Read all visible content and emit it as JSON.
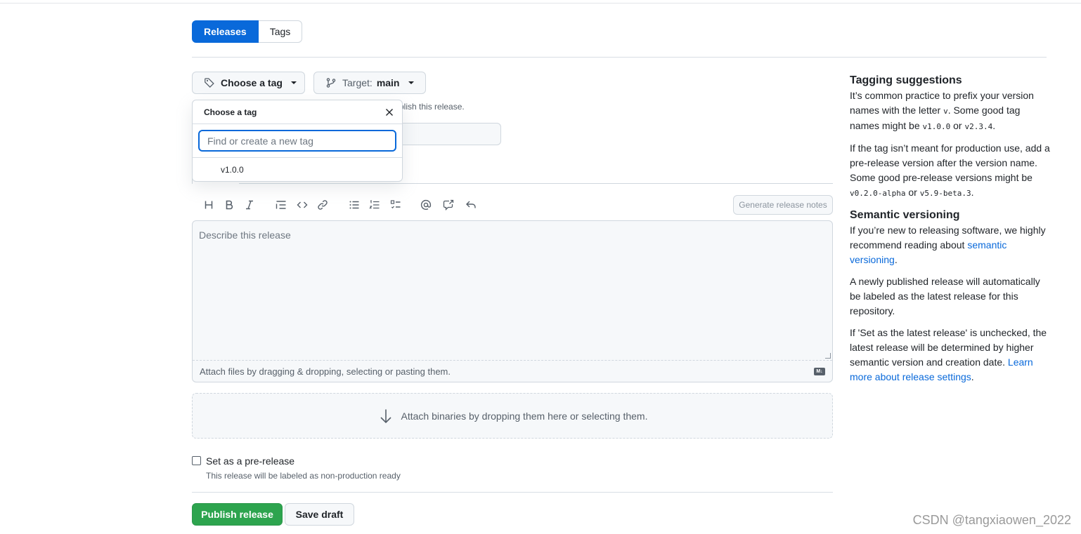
{
  "tabs": {
    "releases": "Releases",
    "tags": "Tags"
  },
  "tag_button": {
    "label": "Choose a tag"
  },
  "target_button": {
    "label": "Target:",
    "value": "main"
  },
  "hint": "blish this release.",
  "dropdown": {
    "title": "Choose a tag",
    "search_placeholder": "Find or create a new tag",
    "items": [
      "v1.0.0"
    ]
  },
  "editor": {
    "generate_notes": "Generate release notes",
    "placeholder": "Describe this release",
    "attach_hint": "Attach files by dragging & dropping, selecting or pasting them.",
    "markdown_badge": "M↓"
  },
  "binaries": {
    "label": "Attach binaries by dropping them here or selecting them."
  },
  "prerelease": {
    "label": "Set as a pre-release",
    "note": "This release will be labeled as non-production ready"
  },
  "actions": {
    "publish": "Publish release",
    "save_draft": "Save draft"
  },
  "sidebar": {
    "tagging_title": "Tagging suggestions",
    "p1_a": "It’s common practice to prefix your version names with the letter ",
    "p1_code1": "v",
    "p1_b": ". Some good tag names might be ",
    "p1_code2": "v1.0.0",
    "p1_c": " or ",
    "p1_code3": "v2.3.4",
    "p1_d": ".",
    "p2_a": "If the tag isn’t meant for production use, add a pre-release version after the version name. Some good pre-release versions might be ",
    "p2_code1": "v0.2.0-alpha",
    "p2_b": " or ",
    "p2_code2": "v5.9-beta.3",
    "p2_c": ".",
    "semver_title": "Semantic versioning",
    "p3_a": "If you’re new to releasing software, we highly recommend reading about ",
    "p3_link": "semantic versioning",
    "p3_b": ".",
    "p4": "A newly published release will automatically be labeled as the latest release for this repository.",
    "p5_a": "If 'Set as the latest release' is unchecked, the latest release will be determined by higher semantic version and creation date. ",
    "p5_link": "Learn more about release settings",
    "p5_b": "."
  },
  "watermark": "CSDN @tangxiaowen_2022",
  "colors": {
    "primary": "#0969da",
    "success": "#2da44e",
    "border": "#d0d7de",
    "muted": "#57606a"
  }
}
